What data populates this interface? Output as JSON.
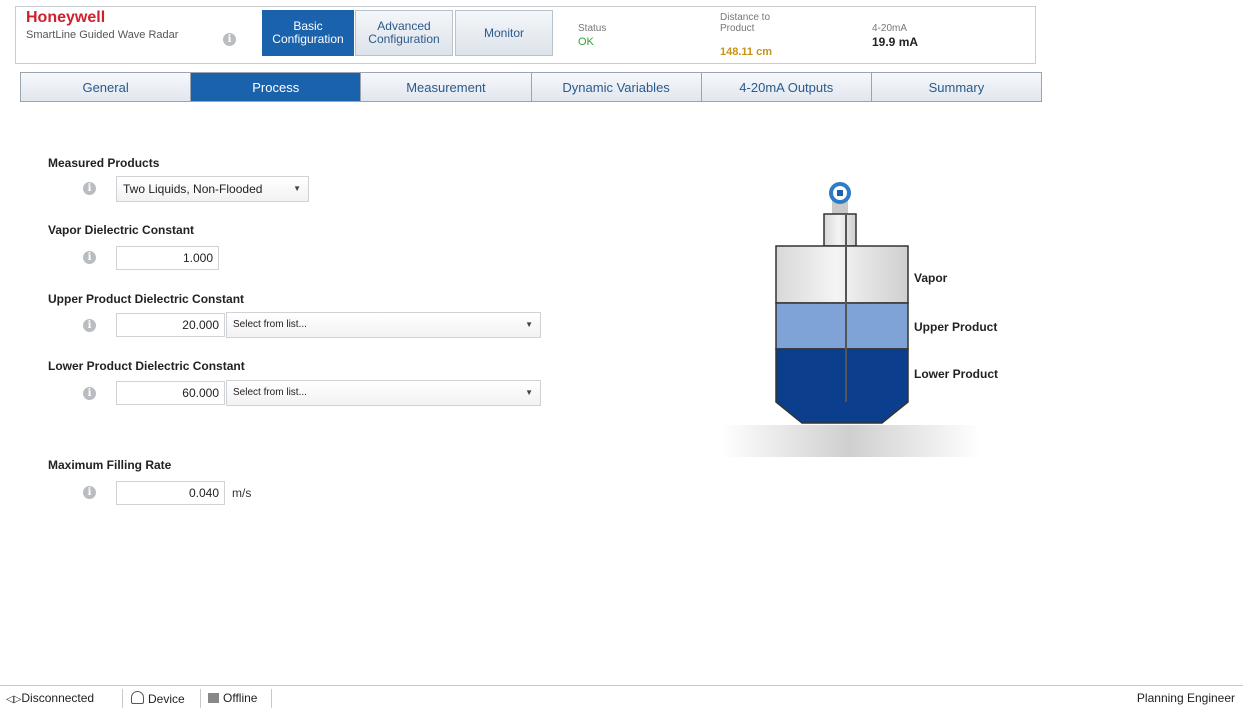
{
  "header": {
    "brand": "Honeywell",
    "product": "SmartLine Guided Wave Radar",
    "tabs": [
      {
        "label_line1": "Basic",
        "label_line2": "Configuration"
      },
      {
        "label_line1": "Advanced",
        "label_line2": "Configuration"
      },
      {
        "label": "Monitor"
      }
    ],
    "status": {
      "label": "Status",
      "value": "OK",
      "color": "#2fa13a"
    },
    "distance": {
      "label_line1": "Distance to",
      "label_line2": "Product",
      "value": "148.11 cm",
      "color": "#c8931a"
    },
    "current": {
      "label": "4-20mA",
      "value": "19.9 mA"
    }
  },
  "subtabs": [
    "General",
    "Process",
    "Measurement",
    "Dynamic Variables",
    "4-20mA Outputs",
    "Summary"
  ],
  "active_subtab": "Process",
  "form": {
    "measured_products": {
      "label": "Measured Products",
      "value": "Two Liquids, Non-Flooded"
    },
    "vapor_dc": {
      "label": "Vapor Dielectric Constant",
      "value": "1.000"
    },
    "upper_dc": {
      "label": "Upper Product Dielectric Constant",
      "value": "20.000",
      "select": "Select from list..."
    },
    "lower_dc": {
      "label": "Lower Product Dielectric Constant",
      "value": "60.000",
      "select": "Select from list..."
    },
    "max_fill": {
      "label": "Maximum Filling Rate",
      "value": "0.040",
      "unit": "m/s"
    }
  },
  "tank": {
    "vapor": "Vapor",
    "upper": "Upper Product",
    "lower": "Lower Product",
    "colors": {
      "upper": "#7fa3d6",
      "lower": "#0b3f8e",
      "vapor": "#e4e4e4"
    }
  },
  "footer": {
    "disconnected": "Disconnected",
    "device": "Device",
    "offline": "Offline",
    "role": "Planning Engineer"
  },
  "accent": "#1b62ad"
}
